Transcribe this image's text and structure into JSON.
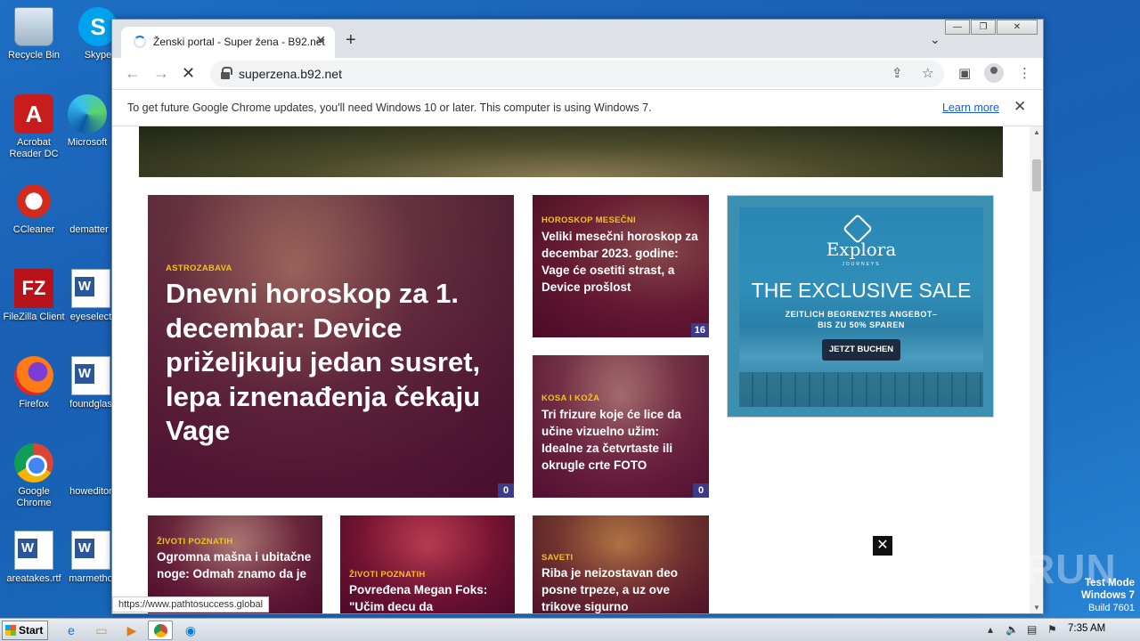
{
  "desktop": {
    "icons": [
      {
        "label": "Recycle Bin",
        "icon": "recycle-bin-icon"
      },
      {
        "label": "Skype",
        "icon": "skype-icon"
      },
      {
        "label": "Acrobat Reader DC",
        "icon": "acrobat-icon"
      },
      {
        "label": "Microsoft",
        "icon": "edge-icon"
      },
      {
        "label": "CCleaner",
        "icon": "ccleaner-icon"
      },
      {
        "label": "dematter",
        "icon": "file-icon"
      },
      {
        "label": "FileZilla Client",
        "icon": "filezilla-icon"
      },
      {
        "label": "eyeselect",
        "icon": "word-doc-icon"
      },
      {
        "label": "Firefox",
        "icon": "firefox-icon"
      },
      {
        "label": "foundglas",
        "icon": "word-doc-icon"
      },
      {
        "label": "Google Chrome",
        "icon": "chrome-icon"
      },
      {
        "label": "howeditor",
        "icon": "file-icon"
      },
      {
        "label": "areatakes.rtf",
        "icon": "word-doc-icon"
      },
      {
        "label": "marmetho",
        "icon": "word-doc-icon"
      }
    ]
  },
  "browser": {
    "tab_title": "Ženski portal - Super žena - B92.net",
    "url": "superzena.b92.net",
    "infobar_text": "To get future Google Chrome updates, you'll need Windows 10 or later. This computer is using Windows 7.",
    "infobar_link": "Learn more",
    "status_url": "https://www.pathtosuccess.global"
  },
  "page": {
    "featured": {
      "category": "ASTROZABAVA",
      "title": "Dnevni horoskop za 1. decembar: Device priželjkuju jedan susret, lepa iznenađenja čekaju Vage",
      "comments": "0"
    },
    "side_cards": [
      {
        "category": "HOROSKOP MESEČNI",
        "title": "Veliki mesečni horoskop za decembar 2023. godine: Vage će osetiti strast, a Device prošlost",
        "comments": "16"
      },
      {
        "category": "KOSA I KOŽA",
        "title": "Tri frizure koje će lice da učine vizuelno užim: Idealne za četvrtaste ili okrugle crte FOTO",
        "comments": "0"
      }
    ],
    "bottom_cards": [
      {
        "category": "ŽIVOTI POZNATIH",
        "title": "Ogromna mašna i ubitačne noge: Odmah znamo da je"
      },
      {
        "category": "ŽIVOTI POZNATIH",
        "title": "Povređena Megan Foks: \"Učim decu da"
      },
      {
        "category": "SAVETI",
        "title": "Riba je neizostavan deo posne trpeze, a uz ove trikove sigurno"
      }
    ],
    "ad": {
      "brand": "Explora",
      "brand_sub": "JOURNEYS",
      "headline": "THE EXCLUSIVE SALE",
      "sub_line1": "ZEITLICH BEGRENZTES ANGEBOT–",
      "sub_line2": "BIS ZU 50% SPAREN",
      "button": "JETZT BUCHEN"
    }
  },
  "watermark": {
    "brand": "ANY RUN",
    "line1": "Test Mode",
    "line2": "Windows 7",
    "line3": "Build 7601"
  },
  "taskbar": {
    "start_label": "Start",
    "clock": "7:35 AM"
  },
  "colors": {
    "accent": "#1a73e8",
    "category": "#f3c31a",
    "count_badge": "#3d3a8a"
  }
}
